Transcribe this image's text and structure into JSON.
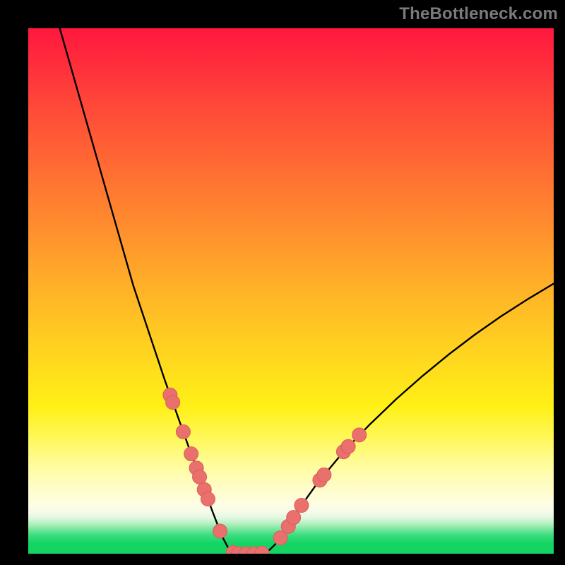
{
  "watermark": "TheBottleneck.com",
  "colors": {
    "frame": "#000000",
    "curve": "#000000",
    "dot_fill": "#e9706c",
    "dot_stroke": "#d85e5a",
    "gradient_stops": [
      "#ff173e",
      "#ff2b3c",
      "#ff4639",
      "#ff6a33",
      "#ff8e2e",
      "#ffb327",
      "#ffd51f",
      "#fff016",
      "#fff85a",
      "#fffb8e",
      "#fffcb1",
      "#fffdcc",
      "#fefde2",
      "#f6fbe9",
      "#e0f8e0",
      "#b3f0c1",
      "#7ce7a0",
      "#3fdd80",
      "#14d564"
    ]
  },
  "chart_data": {
    "type": "line",
    "title": "",
    "xlabel": "",
    "ylabel": "",
    "xlim": [
      0,
      100
    ],
    "ylim": [
      0,
      100
    ],
    "grid": false,
    "legend": false,
    "series": [
      {
        "name": "curve",
        "x": [
          6,
          8,
          10,
          12,
          14,
          16,
          18,
          20,
          22,
          24,
          26,
          27,
          28,
          29,
          30,
          31,
          32,
          33,
          34,
          35,
          36,
          37,
          38,
          39,
          40,
          41,
          42,
          43,
          44,
          45,
          46,
          47,
          48,
          49,
          50,
          52,
          55,
          60,
          65,
          70,
          75,
          80,
          85,
          90,
          95,
          100
        ],
        "y": [
          100,
          93,
          86,
          79,
          72,
          65,
          58,
          51,
          45,
          39,
          33,
          30.2,
          27.4,
          24.6,
          21.8,
          19,
          16.3,
          13.6,
          10.9,
          8.2,
          5.6,
          3.1,
          1.2,
          0.2,
          0,
          0,
          0,
          0,
          0,
          0.2,
          0.8,
          1.8,
          3,
          4.4,
          6,
          9.2,
          13.4,
          19.4,
          24.6,
          29.4,
          33.8,
          37.9,
          41.7,
          45.2,
          48.4,
          51.4
        ]
      }
    ],
    "dots": [
      {
        "x": 27.0,
        "y": 30.2
      },
      {
        "x": 27.5,
        "y": 28.8
      },
      {
        "x": 29.5,
        "y": 23.2
      },
      {
        "x": 31.0,
        "y": 19.0
      },
      {
        "x": 32.0,
        "y": 16.3
      },
      {
        "x": 32.6,
        "y": 14.6
      },
      {
        "x": 33.5,
        "y": 12.2
      },
      {
        "x": 34.2,
        "y": 10.4
      },
      {
        "x": 36.5,
        "y": 4.3
      },
      {
        "x": 39.0,
        "y": 0.2
      },
      {
        "x": 40.0,
        "y": 0.0
      },
      {
        "x": 41.5,
        "y": 0.0
      },
      {
        "x": 43.0,
        "y": 0.0
      },
      {
        "x": 44.5,
        "y": 0.1
      },
      {
        "x": 48.0,
        "y": 3.0
      },
      {
        "x": 49.5,
        "y": 5.2
      },
      {
        "x": 50.5,
        "y": 6.9
      },
      {
        "x": 52.0,
        "y": 9.2
      },
      {
        "x": 55.5,
        "y": 14.0
      },
      {
        "x": 56.3,
        "y": 15.0
      },
      {
        "x": 60.0,
        "y": 19.4
      },
      {
        "x": 60.9,
        "y": 20.4
      },
      {
        "x": 63.0,
        "y": 22.6
      }
    ]
  }
}
